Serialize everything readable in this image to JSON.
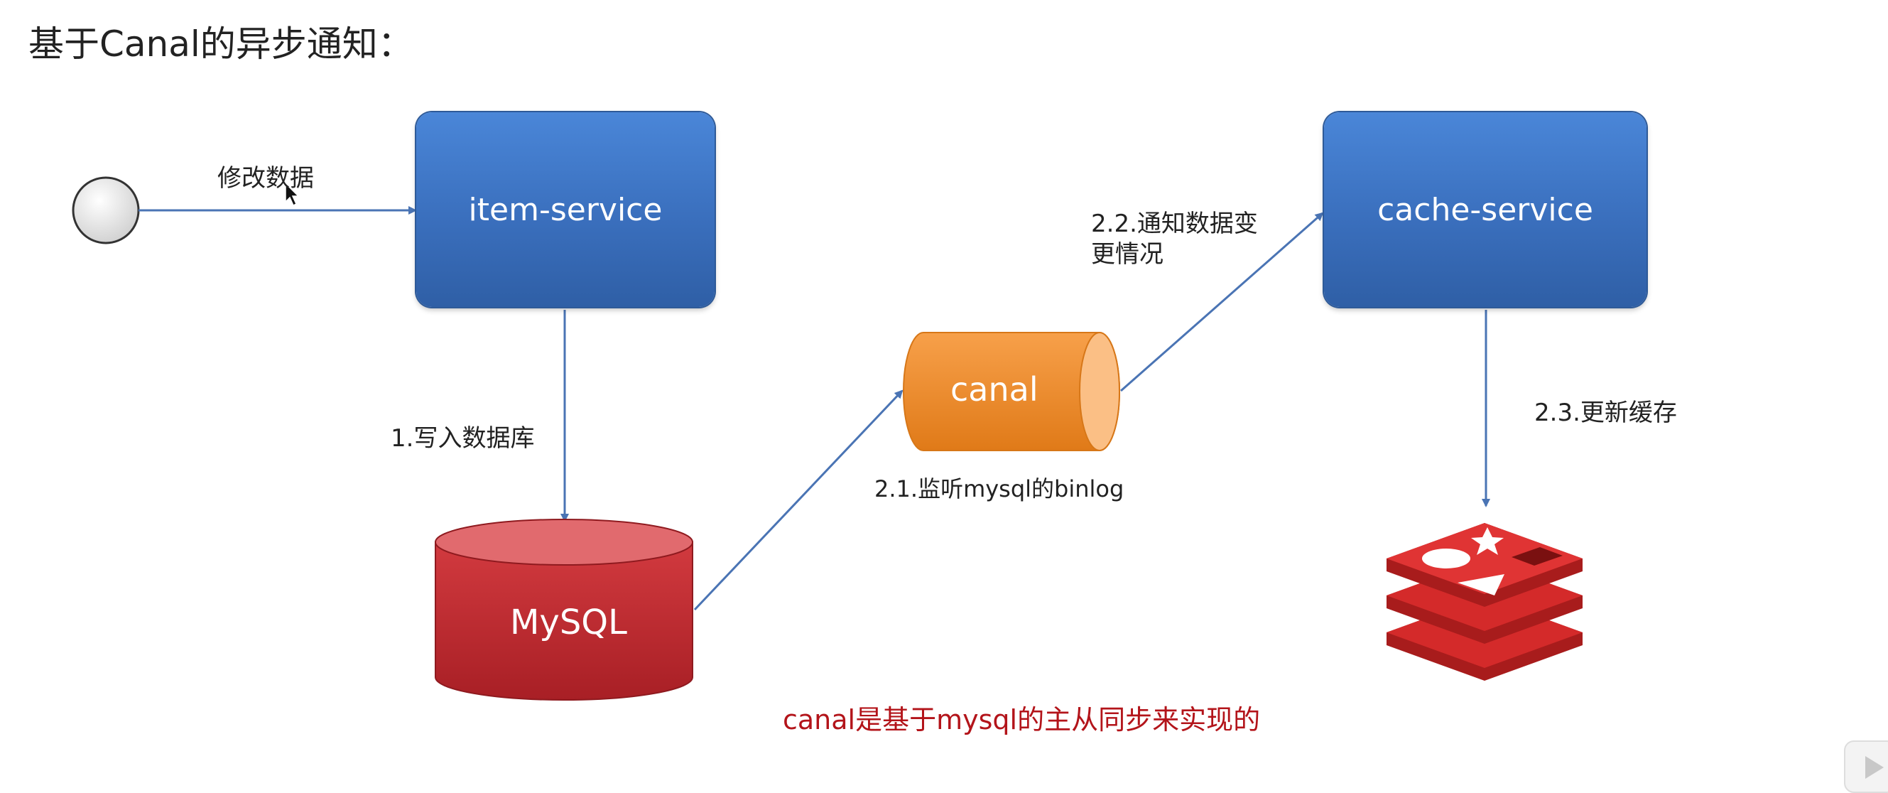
{
  "title": "基于Canal的异步通知：",
  "nodes": {
    "item_service": "item-service",
    "cache_service": "cache-service",
    "canal": "canal",
    "mysql": "MySQL"
  },
  "edges": {
    "modify_data": "修改数据",
    "write_db": "1.写入数据库",
    "listen_binlog": "2.1.监听mysql的binlog",
    "notify_change": "2.2.通知数据变\n更情况",
    "update_cache": "2.3.更新缓存"
  },
  "note": "canal是基于mysql的主从同步来实现的",
  "icons": {
    "start": "start-node-circle-icon",
    "redis": "redis-logo-icon",
    "cursor": "mouse-cursor-icon",
    "player": "play-button-icon"
  },
  "colors": {
    "service_box": "#3a6fbd",
    "canal": "#f28a2a",
    "mysql": "#c8282e",
    "redis": "#d42a2a",
    "arrow": "#4a74b4",
    "note": "#b3141a"
  }
}
